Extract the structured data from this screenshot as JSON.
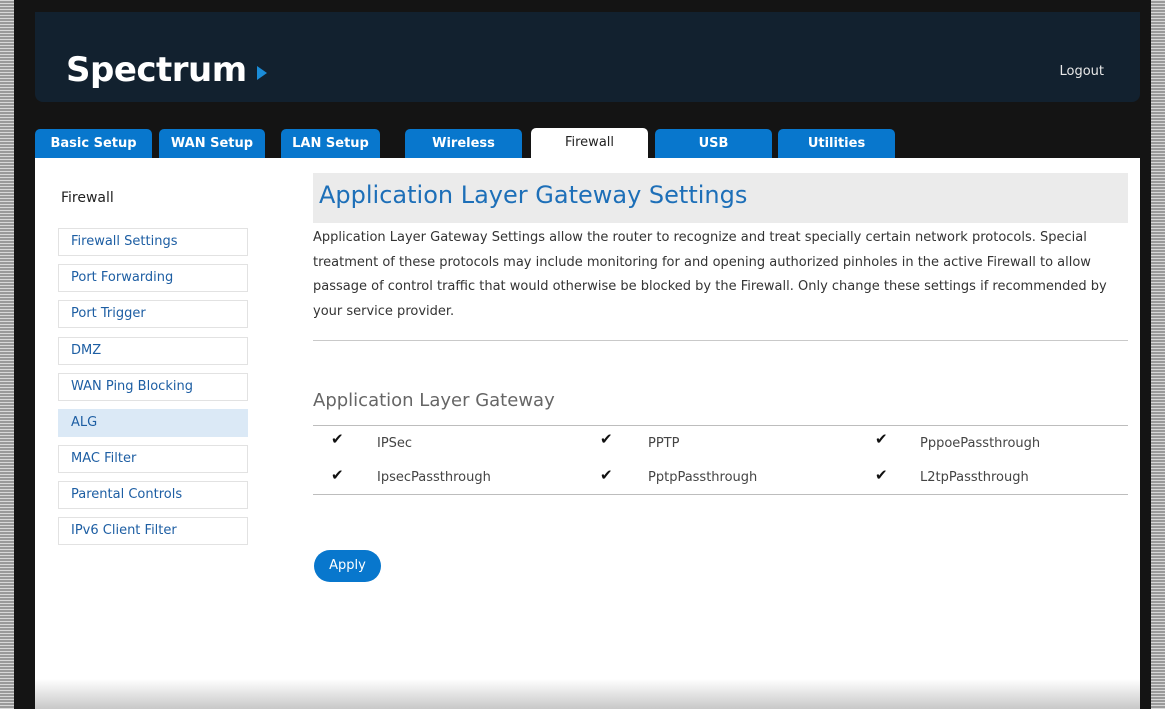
{
  "header": {
    "logo_text": "Spectrum",
    "logout_label": "Logout"
  },
  "tabs": [
    {
      "label": "Basic Setup"
    },
    {
      "label": "WAN Setup"
    },
    {
      "label": "LAN Setup"
    },
    {
      "label": "Wireless"
    },
    {
      "label": "Firewall",
      "active": true
    },
    {
      "label": "USB"
    },
    {
      "label": "Utilities"
    }
  ],
  "sidebar": {
    "title": "Firewall",
    "items": [
      {
        "label": "Firewall Settings"
      },
      {
        "label": "Port Forwarding"
      },
      {
        "label": "Port Trigger"
      },
      {
        "label": "DMZ"
      },
      {
        "label": "WAN Ping Blocking"
      },
      {
        "label": "ALG",
        "active": true
      },
      {
        "label": "MAC Filter"
      },
      {
        "label": "Parental Controls"
      },
      {
        "label": "IPv6 Client Filter"
      }
    ]
  },
  "main": {
    "title": "Application Layer Gateway Settings",
    "description": "Application Layer Gateway Settings allow the router to recognize and treat specially certain network protocols. Special treatment of these protocols may include monitoring for and opening authorized pinholes in the active Firewall to allow passage of control traffic that would otherwise be blocked by the Firewall. Only change these settings if recommended by your service provider.",
    "section_title": "Application Layer Gateway",
    "options": [
      {
        "label": "IPSec",
        "checked": true
      },
      {
        "label": "PPTP",
        "checked": true
      },
      {
        "label": "PppoePassthrough",
        "checked": true
      },
      {
        "label": "IpsecPassthrough",
        "checked": true
      },
      {
        "label": "PptpPassthrough",
        "checked": true
      },
      {
        "label": "L2tpPassthrough",
        "checked": true
      }
    ],
    "checkmark": "✔",
    "apply_label": "Apply"
  },
  "colors": {
    "header_bg": "#12212f",
    "tab_blue": "#0877cd",
    "link_blue": "#1d5ea3",
    "title_blue": "#1d6fb8",
    "active_side_bg": "#dbe9f6"
  }
}
